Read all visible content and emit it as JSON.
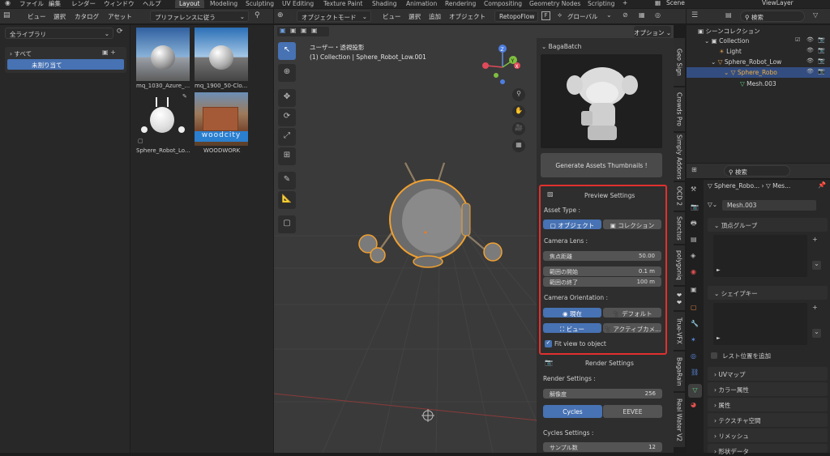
{
  "topbar": {
    "menus": [
      "ファイル",
      "編集",
      "レンダー",
      "ウィンドウ",
      "ヘルプ"
    ],
    "tabs": [
      "Layout",
      "Modeling",
      "Sculpting",
      "UV Editing",
      "Texture Paint",
      "Shading",
      "Animation",
      "Rendering",
      "Compositing",
      "Geometry Nodes",
      "Scripting"
    ],
    "active_tab": "Layout",
    "scene": "Scene",
    "view_layer": "ViewLayer"
  },
  "assets": {
    "menu": [
      "ビュー",
      "選択",
      "カタログ",
      "アセット"
    ],
    "import_dropdown": "プリファレンスに従う",
    "library": "全ライブラリ",
    "catalogs": [
      "すべて",
      "未割り当て"
    ],
    "items": [
      {
        "label": "mq_1030_Azure_..."
      },
      {
        "label": "mq_1900_50-Clo..."
      },
      {
        "label": "Sphere_Robot_Lo..."
      },
      {
        "label": "WOODWORK"
      }
    ],
    "wood_logo": "woodcity"
  },
  "viewport": {
    "mode": "オブジェクトモード",
    "menu": [
      "ビュー",
      "選択",
      "追加",
      "オブジェクト"
    ],
    "addon": "RetopoFlow",
    "transform": "グローバル",
    "options": "オプション",
    "view_name": "ユーザー・透視投影",
    "collection_line": "(1) Collection | Sphere_Robot_Low.001",
    "gizmo_axes": {
      "z": "Z",
      "y": "Y",
      "x": "X"
    }
  },
  "sidebar": {
    "title": "BagaBatch",
    "generate_btn": "Generate Assets Thumbnails !",
    "preview_title": "Preview Settings",
    "asset_type_label": "Asset Type :",
    "asset_type_options": [
      "オブジェクト",
      "コレクション"
    ],
    "camera_lens_label": "Camera Lens :",
    "focal": {
      "label": "焦点距離",
      "value": "50.00"
    },
    "clip_start": {
      "label": "範囲の開始",
      "value": "0.1 m"
    },
    "clip_end": {
      "label": "範囲の終了",
      "value": "100 m"
    },
    "cam_orient_label": "Camera Orientation :",
    "orient_row1": [
      "現在",
      "デフォルト"
    ],
    "orient_row2": [
      "ビュー",
      "アクティブカメ..."
    ],
    "fit_view": "Fit view to object",
    "render_title": "Render Settings",
    "render_settings_label": "Render Settings :",
    "resolution": {
      "label": "解像度",
      "value": "256"
    },
    "engines": [
      "Cycles",
      "EEVEE"
    ],
    "cycles_settings_label": "Cycles Settings :",
    "samples": {
      "label": "サンプル数",
      "value": "12"
    },
    "vtabs": [
      "Geo Sign",
      "Crowds Pro",
      "Simply Addons",
      "OCD 2",
      "Sanctus",
      "polygoniq",
      "",
      "True-VFX",
      "BagaRain",
      "Real Water V2"
    ]
  },
  "outliner": {
    "search_placeholder": "検索",
    "rows": [
      {
        "label": "シーンコレクション",
        "indent": 0
      },
      {
        "label": "Collection",
        "indent": 1
      },
      {
        "label": "Light",
        "indent": 2
      },
      {
        "label": "Sphere_Robot_Low",
        "indent": 2
      },
      {
        "label": "Sphere_Robo",
        "indent": 3
      },
      {
        "label": "Mesh.003",
        "indent": 4
      }
    ]
  },
  "properties": {
    "search_placeholder": "検索",
    "breadcrumb": [
      "Sphere_Robo...",
      "Mes..."
    ],
    "mesh_name": "Mesh.003",
    "sections_open": [
      "頂点グループ",
      "シェイプキー"
    ],
    "rest_position": "レスト位置を追加",
    "sections_closed": [
      "UVマップ",
      "カラー属性",
      "属性",
      "テクスチャ空間",
      "リメッシュ",
      "形状データ"
    ]
  },
  "colors": {
    "accent": "#4772b3",
    "highlight_box": "#e0312f",
    "selection_outline": "#f0a030"
  }
}
